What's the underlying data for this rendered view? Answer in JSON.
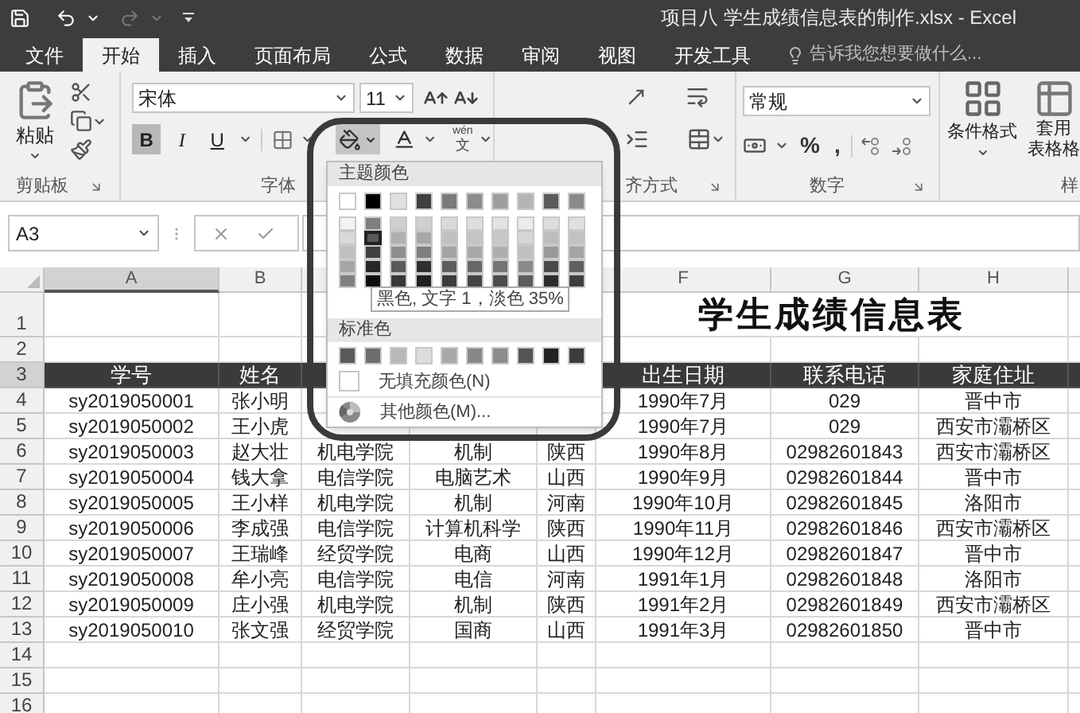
{
  "title_bar": {
    "title": "项目八 学生成绩信息表的制作.xlsx - Excel"
  },
  "tabs": [
    {
      "label": "文件",
      "selected": false
    },
    {
      "label": "开始",
      "selected": true
    },
    {
      "label": "插入",
      "selected": false
    },
    {
      "label": "页面布局",
      "selected": false
    },
    {
      "label": "公式",
      "selected": false
    },
    {
      "label": "数据",
      "selected": false
    },
    {
      "label": "审阅",
      "selected": false
    },
    {
      "label": "视图",
      "selected": false
    },
    {
      "label": "开发工具",
      "selected": false
    }
  ],
  "tell_me": {
    "placeholder": "告诉我您想要做什么..."
  },
  "ribbon": {
    "clipboard": {
      "paste": "粘贴",
      "group_label": "剪贴板"
    },
    "font": {
      "font_name": "宋体",
      "font_size": "11",
      "format_buttons": [
        {
          "label": "B",
          "selected": true
        },
        {
          "label": "I",
          "selected": false
        },
        {
          "label": "U",
          "selected": false
        }
      ],
      "fill_open": true,
      "phonetic_top": "wén",
      "phonetic_bottom": "文",
      "group_label": "字体"
    },
    "alignment": {
      "group_label": "齐方式"
    },
    "number": {
      "format": "常规",
      "symbols": [
        "%",
        ","
      ],
      "group_label": "数字"
    },
    "styles": {
      "conditional": "条件格式",
      "table_format": [
        "套用",
        "表格格"
      ],
      "group_label": "样"
    }
  },
  "formula_bar": {
    "name_box": "A3"
  },
  "fill_menu": {
    "theme_label": "主题颜色",
    "theme_top": [
      {
        "color": "#ffffff",
        "selected": false
      },
      {
        "color": "#000000",
        "selected": false
      },
      {
        "color": "#e0e0e0",
        "selected": false
      },
      {
        "color": "#404040",
        "selected": false
      },
      {
        "color": "#7a7a7a",
        "selected": false
      },
      {
        "color": "#8c8c8c",
        "selected": false
      },
      {
        "color": "#9e9e9e",
        "selected": false
      },
      {
        "color": "#b5b5b5",
        "selected": false
      },
      {
        "color": "#5a5a5a",
        "selected": false
      },
      {
        "color": "#8a8a8a",
        "selected": false
      }
    ],
    "theme_shades": [
      [
        {
          "color": "#f2f2f2",
          "selected": false
        },
        {
          "color": "#7f7f7f",
          "selected": false
        },
        {
          "color": "#cfcfcf",
          "selected": false
        },
        {
          "color": "#d0d0d0",
          "selected": false
        },
        {
          "color": "#dadada",
          "selected": false
        },
        {
          "color": "#dedede",
          "selected": false
        },
        {
          "color": "#e2e2e2",
          "selected": false
        },
        {
          "color": "#ececec",
          "selected": false
        },
        {
          "color": "#dcdcdc",
          "selected": false
        },
        {
          "color": "#e0e0e0",
          "selected": false
        }
      ],
      [
        {
          "color": "#d9d9d9",
          "selected": false
        },
        {
          "color": "#595959",
          "selected": true
        },
        {
          "color": "#b0b0b0",
          "selected": false
        },
        {
          "color": "#a8a8a8",
          "selected": false
        },
        {
          "color": "#c0c0c0",
          "selected": false
        },
        {
          "color": "#c4c4c4",
          "selected": false
        },
        {
          "color": "#c8c8c8",
          "selected": false
        },
        {
          "color": "#d6d6d6",
          "selected": false
        },
        {
          "color": "#bcbcbc",
          "selected": false
        },
        {
          "color": "#c2c2c2",
          "selected": false
        }
      ],
      [
        {
          "color": "#bfbfbf",
          "selected": false
        },
        {
          "color": "#404040",
          "selected": false
        },
        {
          "color": "#8e8e8e",
          "selected": false
        },
        {
          "color": "#7e7e7e",
          "selected": false
        },
        {
          "color": "#a4a4a4",
          "selected": false
        },
        {
          "color": "#a8a8a8",
          "selected": false
        },
        {
          "color": "#aeaeae",
          "selected": false
        },
        {
          "color": "#c0c0c0",
          "selected": false
        },
        {
          "color": "#9a9a9a",
          "selected": false
        },
        {
          "color": "#a4a4a4",
          "selected": false
        }
      ],
      [
        {
          "color": "#a6a6a6",
          "selected": false
        },
        {
          "color": "#262626",
          "selected": false
        },
        {
          "color": "#5a5a5a",
          "selected": false
        },
        {
          "color": "#303030",
          "selected": false
        },
        {
          "color": "#5e5e5e",
          "selected": false
        },
        {
          "color": "#686868",
          "selected": false
        },
        {
          "color": "#747474",
          "selected": false
        },
        {
          "color": "#8a8a8a",
          "selected": false
        },
        {
          "color": "#4a4a4a",
          "selected": false
        },
        {
          "color": "#606060",
          "selected": false
        }
      ],
      [
        {
          "color": "#808080",
          "selected": false
        },
        {
          "color": "#0d0d0d",
          "selected": false
        },
        {
          "color": "#383838",
          "selected": false
        },
        {
          "color": "#202020",
          "selected": false
        },
        {
          "color": "#3c3c3c",
          "selected": false
        },
        {
          "color": "#444444",
          "selected": false
        },
        {
          "color": "#4c4c4c",
          "selected": false
        },
        {
          "color": "#5c5c5c",
          "selected": false
        },
        {
          "color": "#2c2c2c",
          "selected": false
        },
        {
          "color": "#3e3e3e",
          "selected": false
        }
      ]
    ],
    "tooltip": "黑色, 文字 1，淡色 35%",
    "standard_label": "标准色",
    "standard": [
      {
        "color": "#5a5a5a",
        "selected": false
      },
      {
        "color": "#6e6e6e",
        "selected": false
      },
      {
        "color": "#b8b8b8",
        "selected": false
      },
      {
        "color": "#dcdcdc",
        "selected": false
      },
      {
        "color": "#a9a9a9",
        "selected": false
      },
      {
        "color": "#888888",
        "selected": false
      },
      {
        "color": "#8c8c8c",
        "selected": false
      },
      {
        "color": "#555555",
        "selected": false
      },
      {
        "color": "#222222",
        "selected": false
      },
      {
        "color": "#3c3c3c",
        "selected": false
      }
    ],
    "no_fill": "无填充颜色(N)",
    "more_colors": "其他颜色(M)..."
  },
  "sheet": {
    "column_headers": {
      "A": {
        "label": "A",
        "selected": true
      },
      "B": {
        "label": "B",
        "selected": false
      },
      "F": {
        "label": "F",
        "selected": false
      },
      "G": {
        "label": "G",
        "selected": false
      },
      "H": {
        "label": "H",
        "selected": false
      }
    },
    "row_headers": [
      {
        "label": "1",
        "selected": false
      },
      {
        "label": "2",
        "selected": false
      },
      {
        "label": "3",
        "selected": true
      },
      {
        "label": "4",
        "selected": false
      },
      {
        "label": "5",
        "selected": false
      },
      {
        "label": "6",
        "selected": false
      },
      {
        "label": "7",
        "selected": false
      },
      {
        "label": "8",
        "selected": false
      },
      {
        "label": "9",
        "selected": false
      },
      {
        "label": "10",
        "selected": false
      },
      {
        "label": "11",
        "selected": false
      },
      {
        "label": "12",
        "selected": false
      },
      {
        "label": "13",
        "selected": false
      },
      {
        "label": "14",
        "selected": false
      },
      {
        "label": "15",
        "selected": false
      },
      {
        "label": "16",
        "selected": false
      }
    ],
    "title": "学生成绩信息表",
    "header_row": {
      "A": "学号",
      "B": "姓名",
      "F": "出生日期",
      "G": "联系电话",
      "H": "家庭住址"
    },
    "rows": [
      {
        "A": "sy2019050001",
        "B": "张小明",
        "F": "1990年7月",
        "G": "029",
        "H": "晋中市"
      },
      {
        "A": "sy2019050002",
        "B": "王小虎",
        "F": "1990年7月",
        "G": "029",
        "H": "西安市灞桥区"
      },
      {
        "A": "sy2019050003",
        "B": "赵大壮",
        "C": "机电学院",
        "D": "机制",
        "E": "陕西",
        "F": "1990年8月",
        "G": "02982601843",
        "H": "西安市灞桥区"
      },
      {
        "A": "sy2019050004",
        "B": "钱大拿",
        "C": "电信学院",
        "D": "电脑艺术",
        "E": "山西",
        "F": "1990年9月",
        "G": "02982601844",
        "H": "晋中市"
      },
      {
        "A": "sy2019050005",
        "B": "王小样",
        "C": "机电学院",
        "D": "机制",
        "E": "河南",
        "F": "1990年10月",
        "G": "02982601845",
        "H": "洛阳市"
      },
      {
        "A": "sy2019050006",
        "B": "李成强",
        "C": "电信学院",
        "D": "计算机科学",
        "E": "陕西",
        "F": "1990年11月",
        "G": "02982601846",
        "H": "西安市灞桥区"
      },
      {
        "A": "sy2019050007",
        "B": "王瑞峰",
        "C": "经贸学院",
        "D": "电商",
        "E": "山西",
        "F": "1990年12月",
        "G": "02982601847",
        "H": "晋中市"
      },
      {
        "A": "sy2019050008",
        "B": "牟小亮",
        "C": "电信学院",
        "D": "电信",
        "E": "河南",
        "F": "1991年1月",
        "G": "02982601848",
        "H": "洛阳市"
      },
      {
        "A": "sy2019050009",
        "B": "庄小强",
        "C": "机电学院",
        "D": "机制",
        "E": "陕西",
        "F": "1991年2月",
        "G": "02982601849",
        "H": "西安市灞桥区"
      },
      {
        "A": "sy2019050010",
        "B": "张文强",
        "C": "经贸学院",
        "D": "国商",
        "E": "山西",
        "F": "1991年3月",
        "G": "02982601850",
        "H": "晋中市"
      }
    ]
  }
}
